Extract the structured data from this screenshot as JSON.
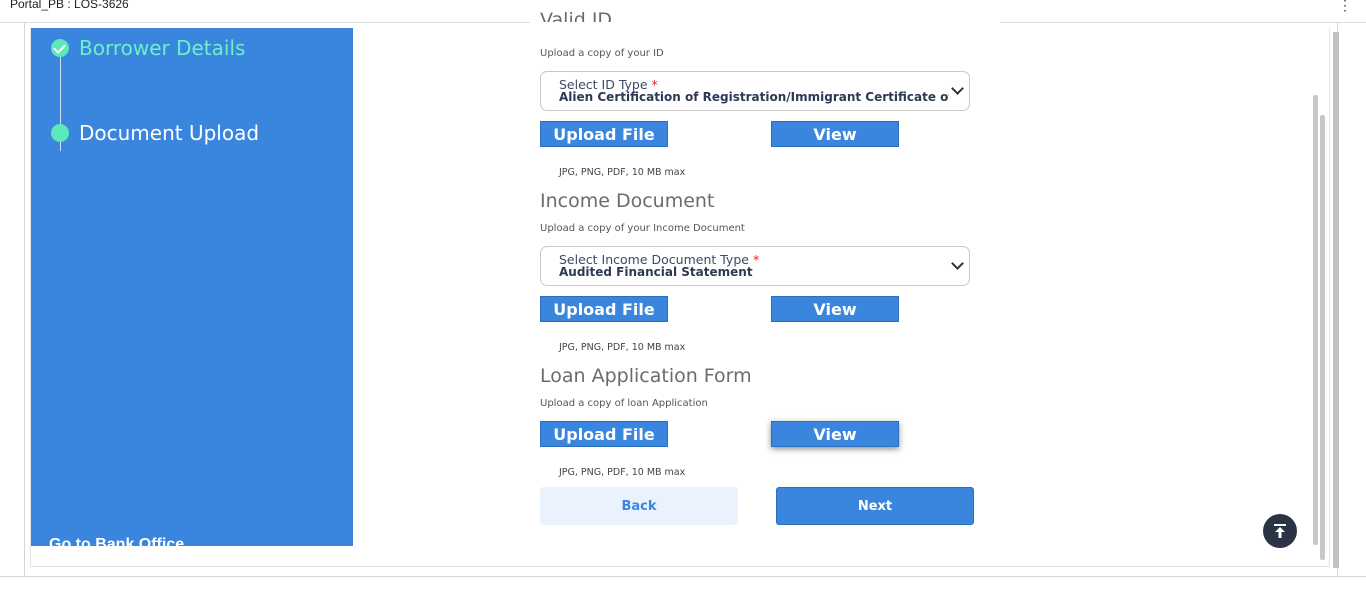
{
  "window": {
    "title": "Portal_PB : LOS-3626",
    "menu_icon": "kebab-menu-icon"
  },
  "sidebar": {
    "steps": [
      {
        "label": "Borrower Details",
        "status": "completed"
      },
      {
        "label": "Document Upload",
        "status": "current"
      }
    ],
    "footer_link": "Go to Bank Office"
  },
  "sections": [
    {
      "title": "Valid ID",
      "subtitle": "Upload a copy of your ID",
      "select_label": "Select ID Type",
      "select_value": "Alien Certification of Registration/Immigrant Certificate of Registration",
      "upload_label": "Upload File",
      "view_label": "View",
      "hint": "JPG, PNG, PDF, 10 MB max"
    },
    {
      "title": "Income Document",
      "subtitle": "Upload a copy of your Income Document",
      "select_label": "Select Income Document Type",
      "select_value": "Audited Financial Statement",
      "upload_label": "Upload File",
      "view_label": "View",
      "hint": "JPG, PNG, PDF, 10 MB max"
    },
    {
      "title": "Loan Application Form",
      "subtitle": "Upload a copy of loan Application",
      "upload_label": "Upload File",
      "view_label": "View",
      "hint": "JPG, PNG, PDF, 10 MB max"
    }
  ],
  "required_marker": "*",
  "nav": {
    "back_label": "Back",
    "next_label": "Next"
  },
  "colors": {
    "primary": "#3a86de",
    "sidebar_bg": "#3a86de",
    "step_done": "#5de8b8",
    "back_bg": "#eaf3fd",
    "to_top_bg": "#2b3444"
  }
}
